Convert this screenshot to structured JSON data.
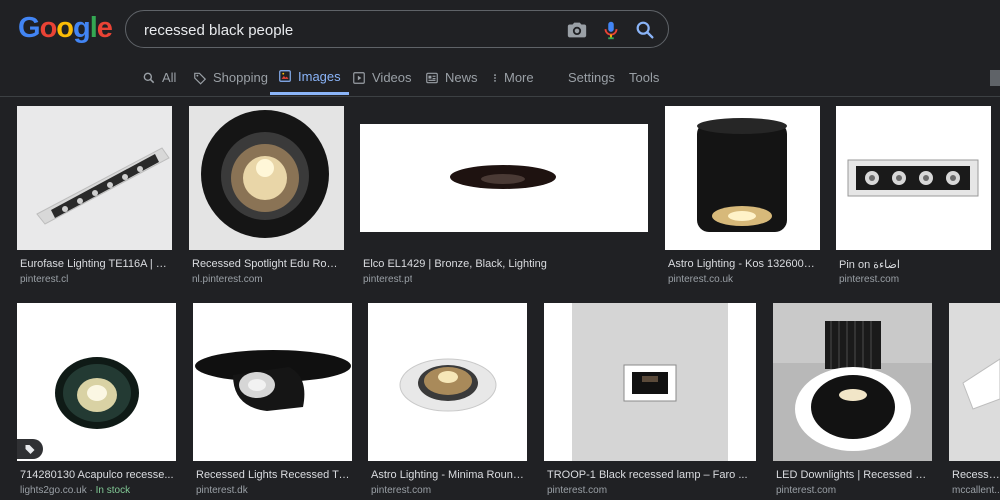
{
  "search": {
    "query": "recessed black people"
  },
  "colors": {
    "background": "#202124",
    "accent": "#8ab4f8",
    "in_stock": "#81c995"
  },
  "tabs": [
    {
      "label": "All",
      "icon": "search-icon"
    },
    {
      "label": "Shopping",
      "icon": "tag-icon"
    },
    {
      "label": "Images",
      "icon": "images-icon",
      "active": true
    },
    {
      "label": "Videos",
      "icon": "play-icon"
    },
    {
      "label": "News",
      "icon": "news-icon"
    },
    {
      "label": "More",
      "icon": "more-vert-icon"
    },
    {
      "label": "Settings"
    },
    {
      "label": "Tools"
    }
  ],
  "results_row1": [
    {
      "title": "Eurofase Lighting TE116A | Li...",
      "source": "pinterest.cl"
    },
    {
      "title": "Recessed Spotlight Edu Roun...",
      "source": "nl.pinterest.com"
    },
    {
      "title": "Elco EL1429 | Bronze, Black, Lighting",
      "source": "pinterest.pt"
    },
    {
      "title": "Astro Lighting - Kos 1326004 ...",
      "source": "pinterest.co.uk"
    },
    {
      "title": "Pin on اضاءة",
      "source": "pinterest.com"
    }
  ],
  "results_row2": [
    {
      "title": "714280130 Acapulco recesse...",
      "source": "lights2go.co.uk",
      "stock": "In stock"
    },
    {
      "title": "Recessed Lights Recessed Tri...",
      "source": "pinterest.dk"
    },
    {
      "title": "Astro Lighting - Minima Round...",
      "source": "pinterest.com"
    },
    {
      "title": "TROOP-1 Black recessed lamp – Faro ...",
      "source": "pinterest.com"
    },
    {
      "title": "LED Downlights | Recessed LE...",
      "source": "pinterest.com"
    },
    {
      "title": "Recessed",
      "source": "mccallent..."
    }
  ]
}
